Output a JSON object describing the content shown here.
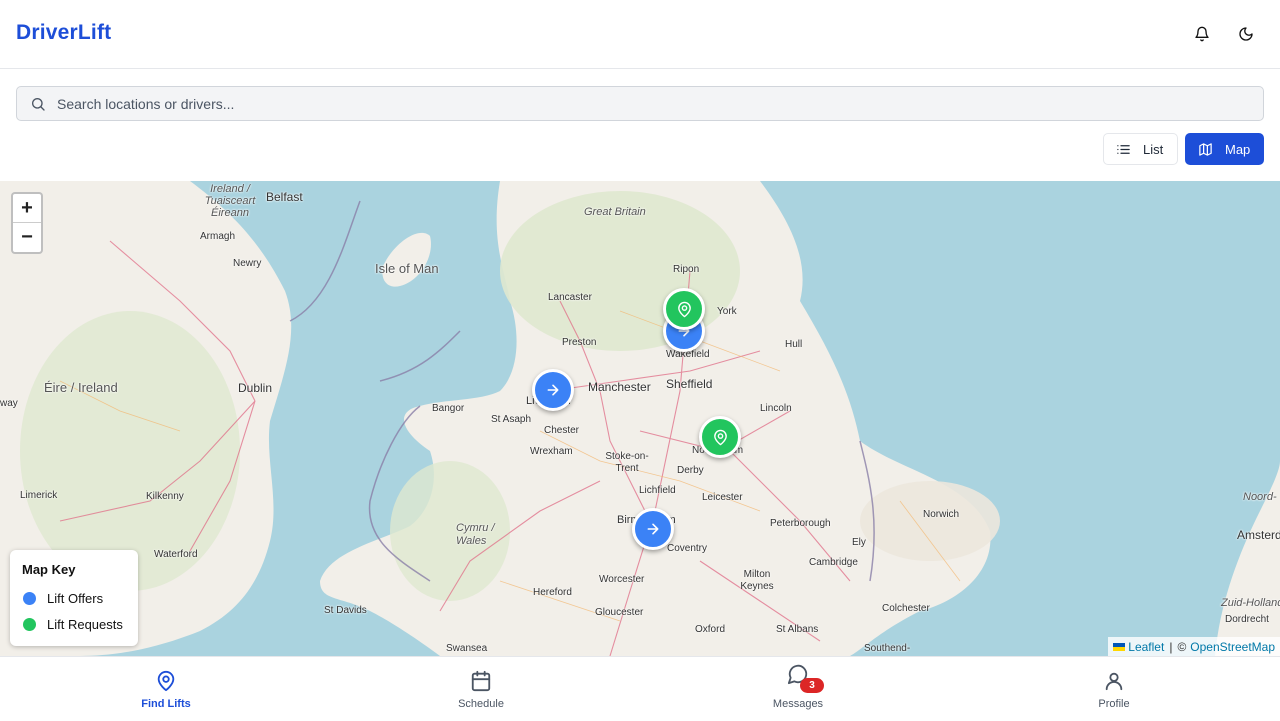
{
  "app": {
    "brand": "DriverLift"
  },
  "search": {
    "placeholder": "Search locations or drivers..."
  },
  "view_toggle": {
    "list_label": "List",
    "map_label": "Map",
    "active": "Map"
  },
  "map": {
    "zoom_in": "+",
    "zoom_out": "−",
    "labels": {
      "great_britain": "Great Britain",
      "ireland": "Ireland / Tuaisceart Éireann",
      "belfast": "Belfast",
      "armagh": "Armagh",
      "newry": "Newry",
      "isle_of_man": "Isle of Man",
      "eire": "Éire / Ireland",
      "dublin": "Dublin",
      "limerick": "Limerick",
      "kilkenny": "Kilkenny",
      "waterford": "Waterford",
      "ripon": "Ripon",
      "york": "York",
      "lancaster": "Lancaster",
      "preston": "Preston",
      "wakefield": "Wakefield",
      "hull": "Hull",
      "manchester": "Manchester",
      "sheffield": "Sheffield",
      "liverpool": "Liverpool",
      "bangor": "Bangor",
      "st_asaph": "St Asaph",
      "chester": "Chester",
      "wrexham": "Wrexham",
      "lincoln": "Lincoln",
      "stoke": "Stoke-on-Trent",
      "derby": "Derby",
      "nottingham": "Nottingham",
      "lichfield": "Lichfield",
      "leicester": "Leicester",
      "norwich": "Norwich",
      "birmingham": "Birmingham",
      "peterborough": "Peterborough",
      "coventry": "Coventry",
      "ely": "Ely",
      "cymru": "Cymru / Wales",
      "cambridge": "Cambridge",
      "worcester": "Worcester",
      "milton_keynes": "Milton Keynes",
      "hereford": "Hereford",
      "st_davids": "St Davids",
      "gloucester": "Gloucester",
      "colchester": "Colchester",
      "oxford": "Oxford",
      "st_albans": "St Albans",
      "swansea": "Swansea",
      "southend": "Southend-",
      "noord": "Noord-",
      "amsterdam": "Amsterdam",
      "zuid_holland": "Zuid-Holland",
      "dordrecht": "Dordrecht",
      "way": "way"
    },
    "markers": [
      {
        "type": "offer",
        "near": "Wakefield"
      },
      {
        "type": "request",
        "near": "Wakefield"
      },
      {
        "type": "offer",
        "near": "Liverpool"
      },
      {
        "type": "request",
        "near": "Nottingham"
      },
      {
        "type": "offer",
        "near": "Birmingham"
      }
    ],
    "key": {
      "title": "Map Key",
      "offers_label": "Lift Offers",
      "requests_label": "Lift Requests",
      "offers_color": "#3b82f6",
      "requests_color": "#22c55e"
    },
    "attribution": {
      "leaflet": "Leaflet",
      "separator": "|",
      "copyright": "©",
      "osm": "OpenStreetMap"
    }
  },
  "nav": {
    "find_lifts": "Find Lifts",
    "schedule": "Schedule",
    "messages": "Messages",
    "messages_badge": "3",
    "profile": "Profile",
    "active": "Find Lifts"
  },
  "colors": {
    "accent": "#1d4ed8",
    "sea": "#aad3df",
    "land": "#f2efe9"
  }
}
